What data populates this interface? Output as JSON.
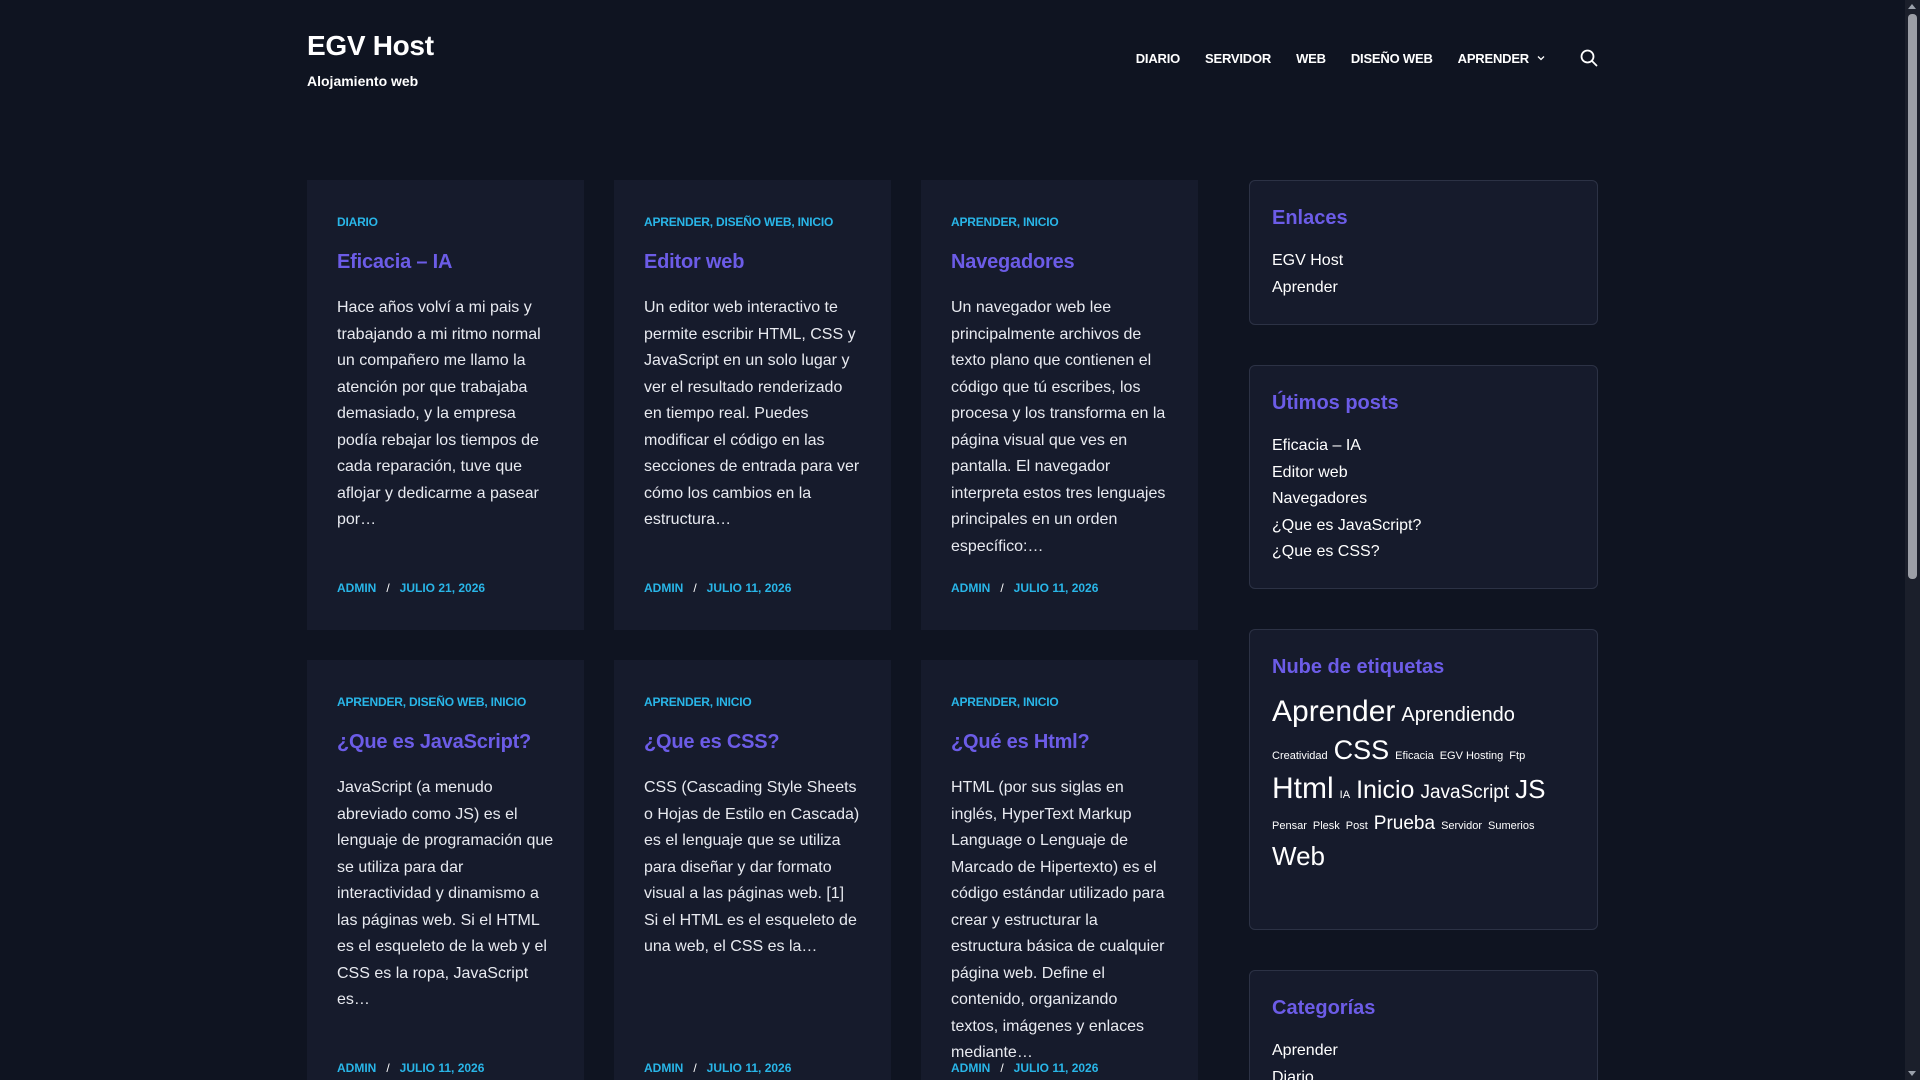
{
  "site": {
    "title": "EGV Host",
    "tagline": "Alojamiento web"
  },
  "nav": {
    "items": [
      "DIARIO",
      "SERVIDOR",
      "WEB",
      "DISEÑO WEB",
      "APRENDER"
    ],
    "search_icon": "search-icon",
    "dropdown_icon": "chevron-down-icon"
  },
  "posts": [
    {
      "categories": [
        "DIARIO"
      ],
      "title": "Eficacia – IA",
      "excerpt": "Hace años volví a mi pais y trabajando a mi ritmo normal un compañero me llamo la atención por que trabajaba demasiado, y la empresa podía rebajar los tiempos de cada reparación, tuve que aflojar y dedicarme a pasear por…",
      "author": "ADMIN",
      "date": "JULIO 21, 2026"
    },
    {
      "categories": [
        "APRENDER",
        "DISEÑO WEB",
        "INICIO"
      ],
      "title": "Editor web",
      "excerpt": "Un editor web interactivo te permite escribir HTML, CSS y JavaScript en un solo lugar y ver el resultado renderizado en tiempo real. Puedes modificar el código en las secciones de entrada para ver cómo los cambios en la estructura…",
      "author": "ADMIN",
      "date": "JULIO 11, 2026"
    },
    {
      "categories": [
        "APRENDER",
        "INICIO"
      ],
      "title": "Navegadores",
      "excerpt": "Un navegador web lee principalmente archivos de texto plano que contienen el código que tú escribes, los procesa y los transforma en la página visual que ves en pantalla. El navegador interpreta estos tres lenguajes principales en un orden específico:…",
      "author": "ADMIN",
      "date": "JULIO 11, 2026"
    },
    {
      "categories": [
        "APRENDER",
        "DISEÑO WEB",
        "INICIO"
      ],
      "title": "¿Que es JavaScript?",
      "excerpt": "JavaScript (a menudo abreviado como JS) es el lenguaje de programación que se utiliza para dar interactividad y dinamismo a las páginas web. Si el HTML es el esqueleto de la web y el CSS es la ropa, JavaScript es…",
      "author": "ADMIN",
      "date": "JULIO 11, 2026"
    },
    {
      "categories": [
        "APRENDER",
        "INICIO"
      ],
      "title": "¿Que es CSS?",
      "excerpt": "CSS (Cascading Style Sheets o Hojas de Estilo en Cascada) es el lenguaje que se utiliza para diseñar y dar formato visual a las páginas web. [1] Si el HTML es el esqueleto de una web, el CSS es la…",
      "author": "ADMIN",
      "date": "JULIO 11, 2026"
    },
    {
      "categories": [
        "APRENDER",
        "INICIO"
      ],
      "title": "¿Qué es Html?",
      "excerpt": "HTML (por sus siglas en inglés, HyperText Markup Language o Lenguaje de Marcado de Hipertexto) es el código estándar utilizado para crear y estructurar la estructura básica de cualquier página web. Define el contenido, organizando textos, imágenes y enlaces mediante…",
      "author": "ADMIN",
      "date": "JULIO 11, 2026"
    }
  ],
  "sidebar": {
    "links": {
      "title": "Enlaces",
      "items": [
        "EGV Host",
        "Aprender"
      ]
    },
    "recent": {
      "title": "Útimos posts",
      "items": [
        "Eficacia – IA",
        "Editor web",
        "Navegadores",
        "¿Que es JavaScript?",
        "¿Que es CSS?"
      ]
    },
    "tagcloud": {
      "title": "Nube de etiquetas",
      "lines": [
        [
          {
            "label": "Aprender",
            "size": 30
          },
          {
            "label": "Aprendiendo",
            "size": 20
          }
        ],
        [
          {
            "label": "Creatividad",
            "size": 11
          },
          {
            "label": "CSS",
            "size": 27
          },
          {
            "label": "Eficacia",
            "size": 11
          },
          {
            "label": "EGV Hosting",
            "size": 11
          },
          {
            "label": "Ftp",
            "size": 11
          }
        ],
        [
          {
            "label": "Html",
            "size": 30
          },
          {
            "label": "IA",
            "size": 11
          },
          {
            "label": "Inicio",
            "size": 25
          },
          {
            "label": "JavaScript",
            "size": 19
          },
          {
            "label": "JS",
            "size": 26
          }
        ],
        [
          {
            "label": "Pensar",
            "size": 11
          },
          {
            "label": "Plesk",
            "size": 11
          },
          {
            "label": "Post",
            "size": 11
          },
          {
            "label": "Prueba",
            "size": 19
          },
          {
            "label": "Servidor",
            "size": 11
          },
          {
            "label": "Sumerios",
            "size": 11
          }
        ],
        [
          {
            "label": "Web",
            "size": 26
          }
        ]
      ]
    },
    "categories": {
      "title": "Categorías",
      "items": [
        "Aprender",
        "Diario"
      ]
    }
  }
}
